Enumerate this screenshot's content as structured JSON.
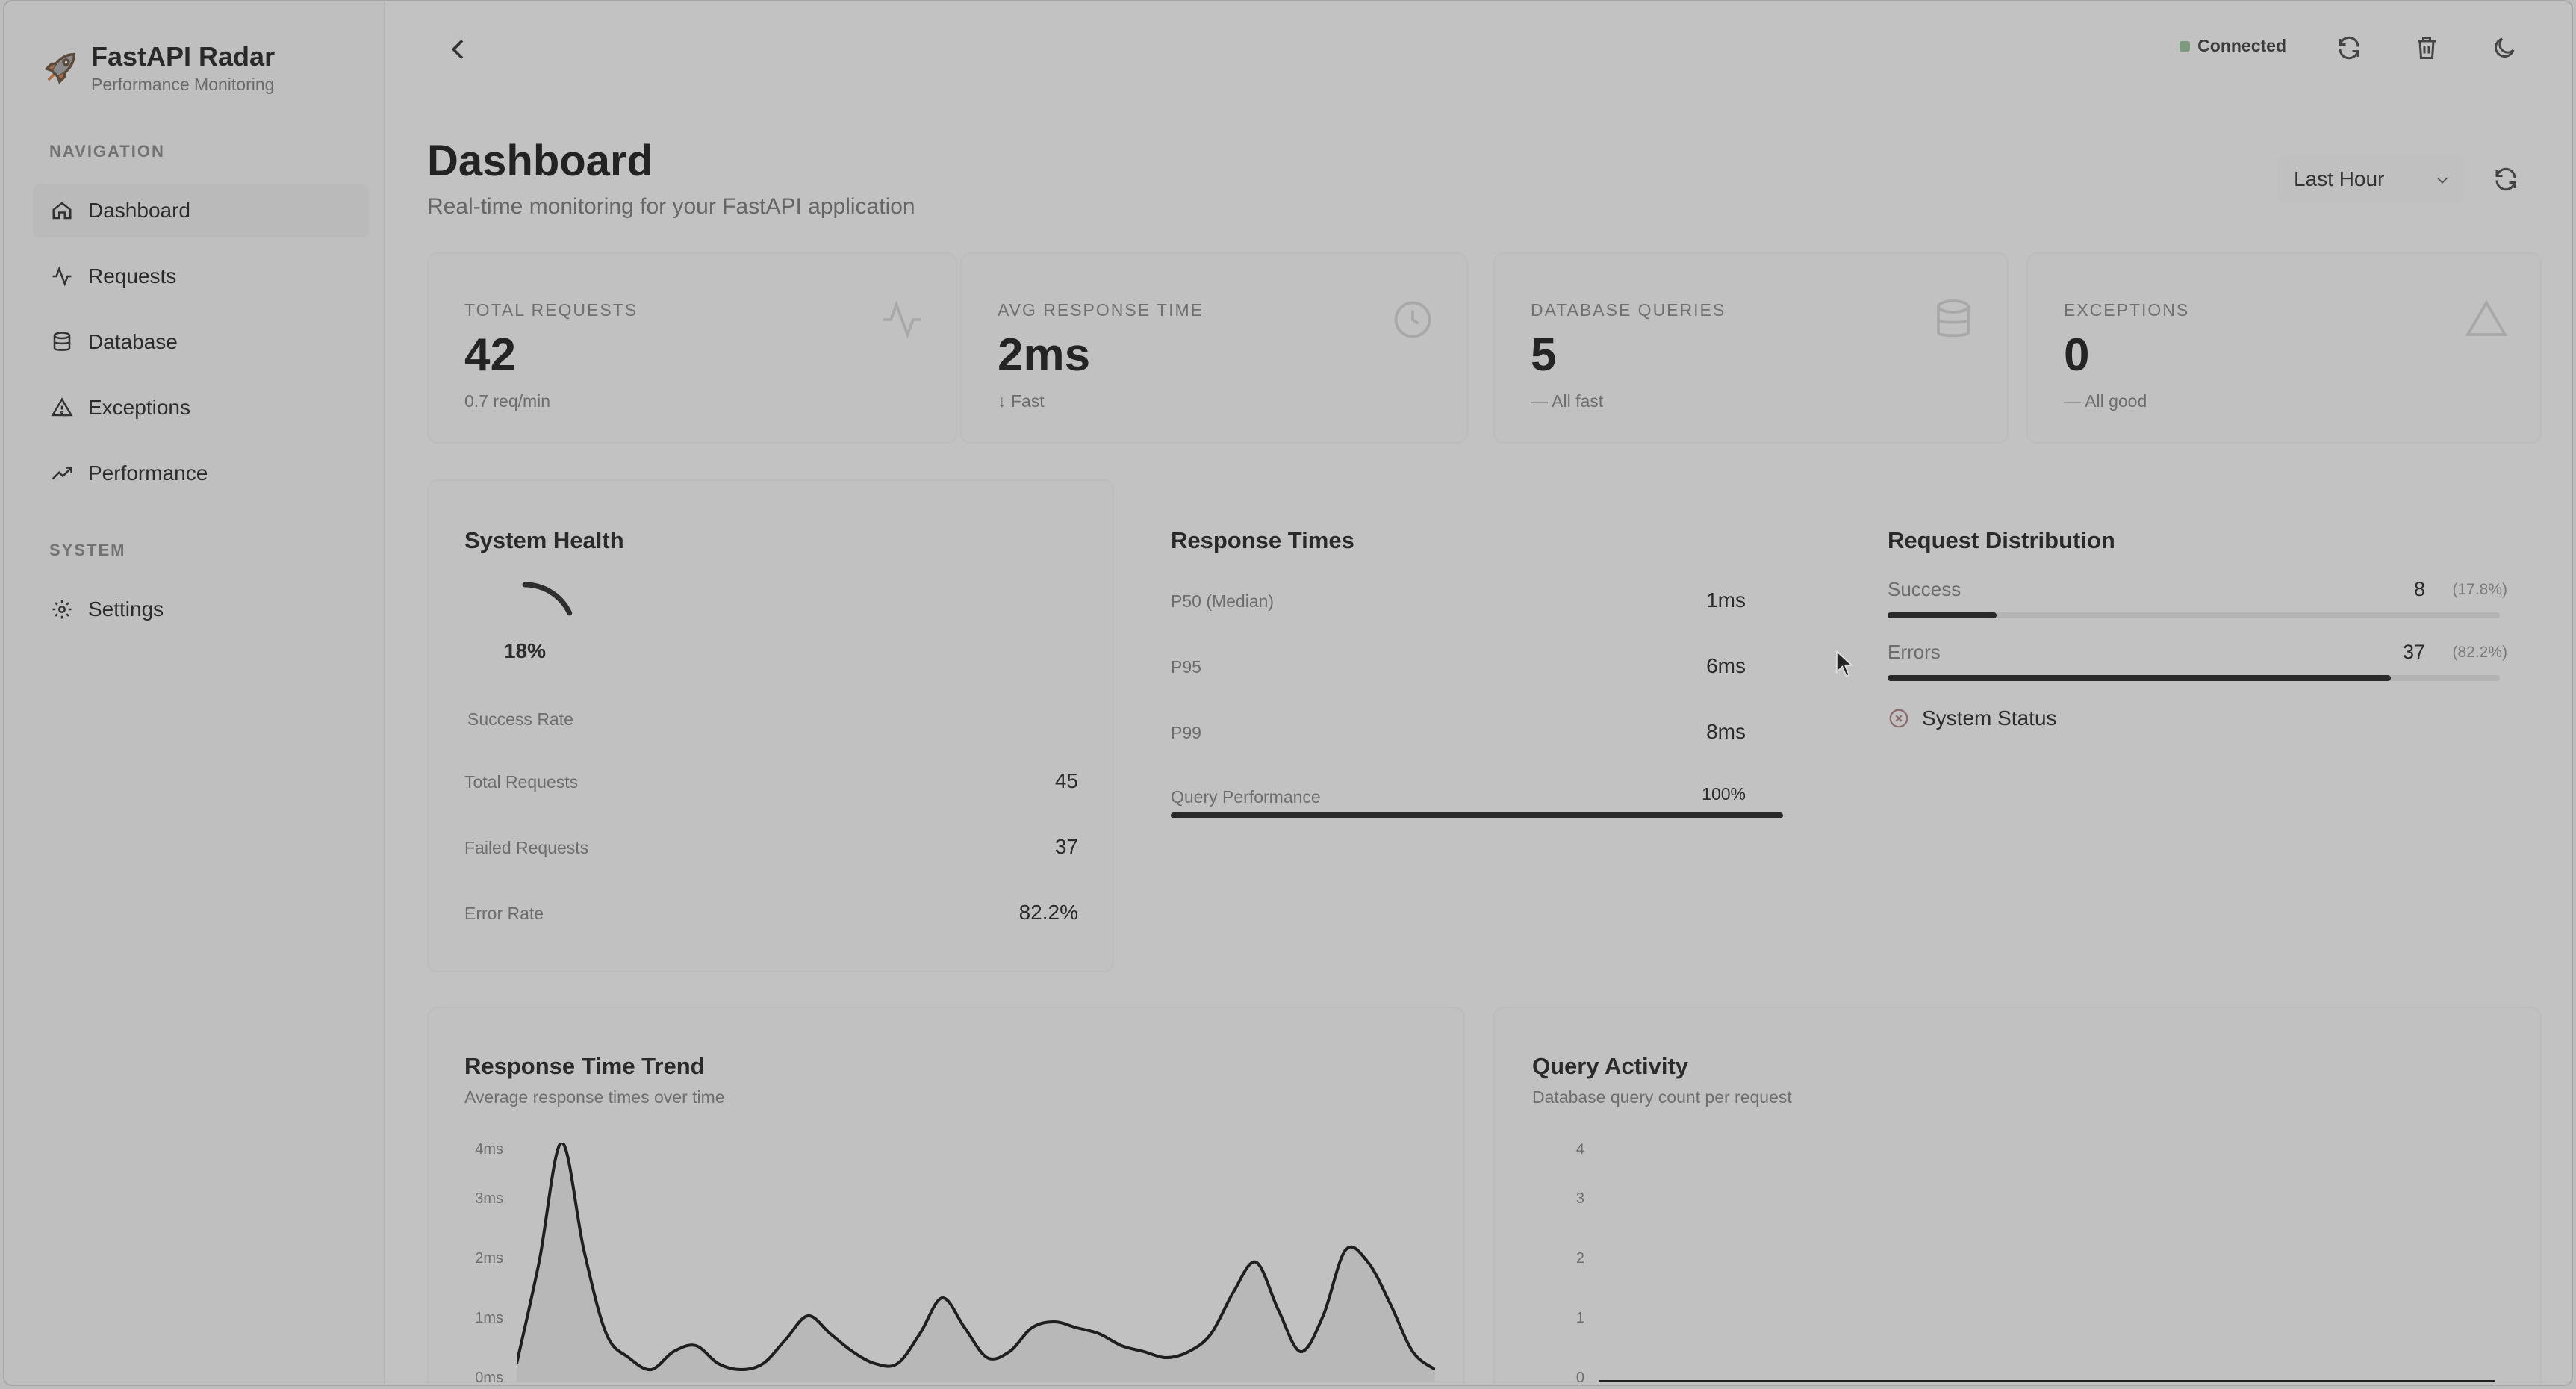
{
  "app": {
    "title": "FastAPI Radar",
    "subtitle": "Performance Monitoring"
  },
  "nav": {
    "section_label": "NAVIGATION",
    "items": [
      {
        "label": "Dashboard",
        "icon": "home-icon"
      },
      {
        "label": "Requests",
        "icon": "activity-icon"
      },
      {
        "label": "Database",
        "icon": "database-icon"
      },
      {
        "label": "Exceptions",
        "icon": "warning-icon"
      },
      {
        "label": "Performance",
        "icon": "trending-up-icon"
      }
    ],
    "system_label": "SYSTEM",
    "settings_label": "Settings"
  },
  "topbar": {
    "status": "Connected",
    "status_color": "#7e9a7e"
  },
  "page": {
    "title": "Dashboard",
    "subtitle": "Real-time monitoring for your FastAPI application",
    "time_range": "Last Hour"
  },
  "stats": [
    {
      "label": "TOTAL REQUESTS",
      "value": "42",
      "note": "0.7 req/min",
      "icon": "activity-icon"
    },
    {
      "label": "AVG RESPONSE TIME",
      "value": "2ms",
      "note": "↓ Fast",
      "icon": "clock-icon"
    },
    {
      "label": "DATABASE QUERIES",
      "value": "5",
      "note": "— All fast",
      "icon": "database-icon"
    },
    {
      "label": "EXCEPTIONS",
      "value": "0",
      "note": "— All good",
      "icon": "warning-icon"
    }
  ],
  "system_health": {
    "title": "System Health",
    "gauge_value": "18%",
    "gauge_fraction": 0.18,
    "gauge_caption": "Success Rate",
    "rows": [
      {
        "label": "Total Requests",
        "value": "45"
      },
      {
        "label": "Failed Requests",
        "value": "37"
      },
      {
        "label": "Error Rate",
        "value": "82.2%"
      }
    ]
  },
  "response_times": {
    "title": "Response Times",
    "rows": [
      {
        "label": "P50 (Median)",
        "value": "1ms"
      },
      {
        "label": "P95",
        "value": "6ms"
      },
      {
        "label": "P99",
        "value": "8ms"
      }
    ],
    "query_perf_label": "Query Performance",
    "query_perf_value": "100%",
    "query_perf_fraction": 1.0
  },
  "request_distribution": {
    "title": "Request Distribution",
    "success_label": "Success",
    "success_value": "8",
    "success_pct": "(17.8%)",
    "success_fraction": 0.178,
    "errors_label": "Errors",
    "errors_value": "37",
    "errors_pct": "(82.2%)",
    "errors_fraction": 0.822,
    "system_status_label": "System Status"
  },
  "response_trend": {
    "title": "Response Time Trend",
    "subtitle": "Average response times over time",
    "y_ticks": [
      "4ms",
      "3ms",
      "2ms",
      "1ms",
      "0ms"
    ]
  },
  "query_activity": {
    "title": "Query Activity",
    "subtitle": "Database query count per request",
    "y_ticks": [
      "4",
      "3",
      "2",
      "1",
      "0"
    ]
  },
  "chart_data": [
    {
      "type": "area",
      "title": "Response Time Trend",
      "ylim": [
        0,
        4
      ],
      "ylabel": "",
      "x": [
        0,
        1,
        2,
        3,
        4,
        5,
        6,
        7,
        8,
        9,
        10,
        11,
        12,
        13,
        14,
        15,
        16,
        17,
        18,
        19,
        20,
        21,
        22,
        23,
        24,
        25,
        26,
        27,
        28,
        29,
        30,
        31,
        32,
        33,
        34,
        35,
        36,
        37,
        38,
        39,
        40,
        41
      ],
      "values": [
        0.3,
        2.0,
        4.0,
        2.2,
        0.8,
        0.4,
        0.2,
        0.5,
        0.6,
        0.3,
        0.2,
        0.3,
        0.7,
        1.1,
        0.8,
        0.5,
        0.3,
        0.3,
        0.8,
        1.4,
        0.9,
        0.4,
        0.5,
        0.9,
        1.0,
        0.9,
        0.8,
        0.6,
        0.5,
        0.4,
        0.5,
        0.8,
        1.5,
        2.0,
        1.2,
        0.5,
        1.1,
        2.2,
        2.0,
        1.3,
        0.5,
        0.2
      ]
    },
    {
      "type": "line",
      "title": "Query Activity",
      "ylim": [
        0,
        4
      ],
      "x": [
        0,
        1,
        2,
        3,
        4,
        5,
        6,
        7,
        8,
        9,
        10,
        11,
        12,
        13,
        14,
        15,
        16,
        17,
        18,
        19,
        20,
        21,
        22,
        23,
        24,
        25,
        26,
        27,
        28,
        29,
        30,
        31,
        32,
        33,
        34,
        35,
        36,
        37,
        38,
        39,
        40,
        41
      ],
      "values": [
        0,
        0,
        0,
        0,
        0,
        0,
        0,
        0,
        0,
        0,
        0,
        0,
        0,
        0,
        0,
        0,
        0,
        0,
        0,
        0,
        0,
        0,
        0,
        0,
        0,
        0,
        0,
        0,
        0,
        0,
        0,
        0,
        0,
        0,
        0,
        0,
        0,
        0,
        0,
        0,
        0,
        0
      ]
    }
  ]
}
